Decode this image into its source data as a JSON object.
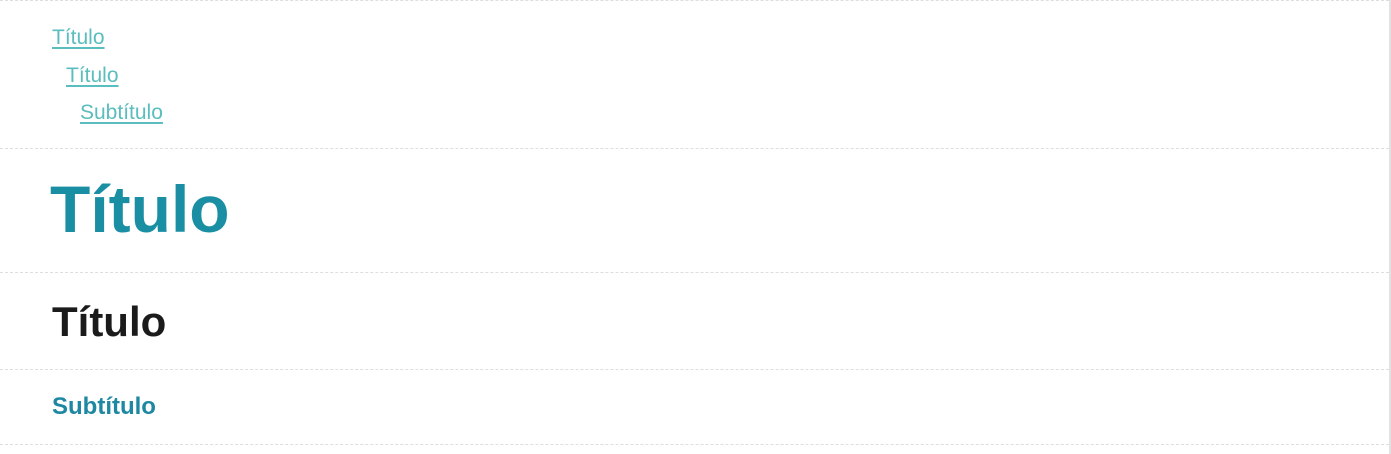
{
  "toc": {
    "items": [
      {
        "label": "Título",
        "level": 1
      },
      {
        "label": "Título",
        "level": 2
      },
      {
        "label": "Subtítulo",
        "level": 3
      }
    ]
  },
  "headings": {
    "h1": "Título",
    "h2": "Título",
    "h3": "Subtítulo"
  },
  "colors": {
    "link": "#5bbdbd",
    "h1": "#1a8fa3",
    "h2": "#1b1b1b",
    "h3": "#1e87a2",
    "divider": "#dedede"
  }
}
